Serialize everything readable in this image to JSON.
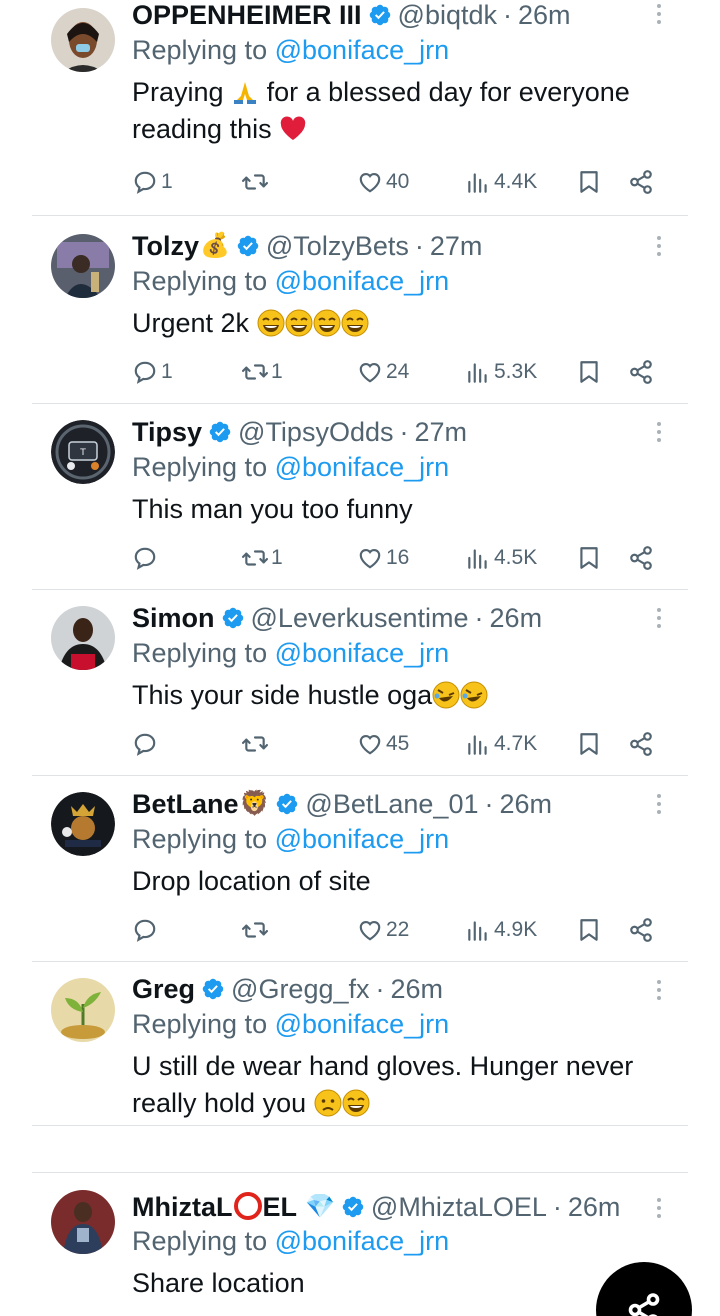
{
  "tweets": [
    {
      "name": "OPPENHEIMER III",
      "badge": "",
      "handle": "@biqtdk",
      "time": "26m",
      "replying_prefix": "Replying to",
      "replying_to": "@boniface_jrn",
      "text_parts": [
        "Praying ",
        " for a blessed day for everyone reading this "
      ],
      "replies": "1",
      "retweets": "",
      "likes": "40",
      "views": "4.4K"
    },
    {
      "name": "Tolzy",
      "badge": "💰",
      "handle": "@TolzyBets",
      "time": "27m",
      "replying_prefix": "Replying to",
      "replying_to": "@boniface_jrn",
      "text": "Urgent 2k ",
      "replies": "1",
      "retweets": "1",
      "likes": "24",
      "views": "5.3K"
    },
    {
      "name": "Tipsy",
      "badge": "",
      "handle": "@TipsyOdds",
      "time": "27m",
      "replying_prefix": "Replying to",
      "replying_to": "@boniface_jrn",
      "text": "This man you too funny",
      "replies": "",
      "retweets": "1",
      "likes": "16",
      "views": "4.5K"
    },
    {
      "name": "Simon",
      "badge": "",
      "handle": "@Leverkusentime",
      "time": "26m",
      "replying_prefix": "Replying to",
      "replying_to": "@boniface_jrn",
      "text": "This your side hustle oga",
      "replies": "",
      "retweets": "",
      "likes": "45",
      "views": "4.7K"
    },
    {
      "name": "BetLane",
      "badge": "🦁",
      "handle": "@BetLane_01",
      "time": "26m",
      "replying_prefix": "Replying to",
      "replying_to": "@boniface_jrn",
      "text": "Drop location of site",
      "replies": "",
      "retweets": "",
      "likes": "22",
      "views": "4.9K"
    },
    {
      "name": "Greg",
      "badge": "",
      "handle": "@Gregg_fx",
      "time": "26m",
      "replying_prefix": "Replying to",
      "replying_to": "@boniface_jrn",
      "text_line1": "U still de wear hand gloves. Hunger never",
      "text_line2": "really hold you "
    },
    {
      "name": "MhiztaL",
      "name_suffix": "EL",
      "badge": "💎",
      "handle": "@MhiztaLOEL",
      "time": "26m",
      "replying_prefix": "Replying to",
      "replying_to": "@boniface_jrn",
      "text": "Share location"
    }
  ],
  "colors": {
    "accent": "#1d9bf0",
    "muted": "#536471",
    "text": "#0f1419",
    "like": "#536471"
  },
  "icons": [
    "reply-icon",
    "retweet-icon",
    "like-icon",
    "views-icon",
    "bookmark-icon",
    "share-icon",
    "verified-icon",
    "more-icon",
    "compose-share-icon"
  ]
}
